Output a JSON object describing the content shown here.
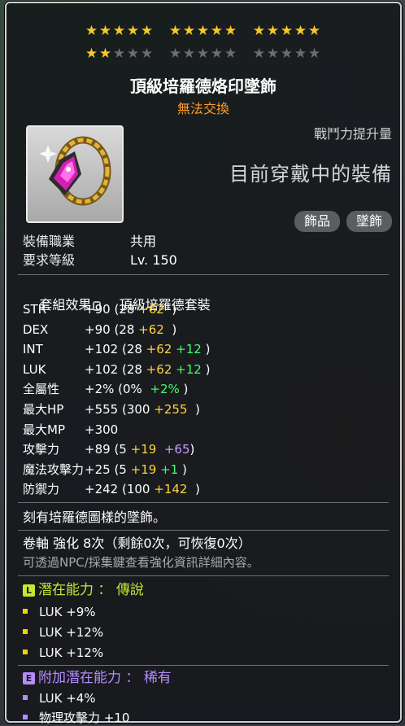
{
  "stars": {
    "rows": [
      [
        5,
        5,
        5
      ],
      [
        2,
        0,
        0
      ]
    ],
    "max_per_group": 5,
    "filled": 17
  },
  "item": {
    "name": "頂級培羅德烙印墜飾",
    "untradeable": "無法交換",
    "combat_power_label": "戰鬥力提升量",
    "equipped_text": "目前穿戴中的裝備",
    "tags": [
      "飾品",
      "墜飾"
    ],
    "icon": "gem-pendant-icon"
  },
  "requirements": [
    {
      "key": "裝備職業",
      "value": "共用"
    },
    {
      "key": "要求等級",
      "value": "Lv. 150"
    }
  ],
  "set_effect": {
    "label": "套組效果",
    "name": "頂級培羅德套裝"
  },
  "stats": [
    {
      "key": "STR",
      "total": "+90",
      "base": "(28",
      "yellow": "+62",
      "green": "",
      "purple": "",
      "close": ")"
    },
    {
      "key": "DEX",
      "total": "+90",
      "base": "(28",
      "yellow": "+62",
      "green": "",
      "purple": "",
      "close": ")"
    },
    {
      "key": "INT",
      "total": "+102",
      "base": "(28",
      "yellow": "+62",
      "green": "+12",
      "purple": "",
      "close": ")"
    },
    {
      "key": "LUK",
      "total": "+102",
      "base": "(28",
      "yellow": "+62",
      "green": "+12",
      "purple": "",
      "close": ")"
    },
    {
      "key": "全屬性",
      "total": "+2%",
      "base": "(0%",
      "yellow": "",
      "green": "+2%",
      "purple": "",
      "close": ")"
    },
    {
      "key": "最大HP",
      "total": "+555",
      "base": "(300",
      "yellow": "+255",
      "green": "",
      "purple": "",
      "close": ")"
    },
    {
      "key": "最大MP",
      "total": "+300",
      "base": "",
      "yellow": "",
      "green": "",
      "purple": "",
      "close": ""
    },
    {
      "key": "攻擊力",
      "total": "+89",
      "base": "(5",
      "yellow": "+19",
      "green": "",
      "purple": "+65",
      "close": ")"
    },
    {
      "key": "魔法攻擊力",
      "total": "+25",
      "base": "(5",
      "yellow": "+19",
      "green": "+1",
      "purple": "",
      "close": ")"
    },
    {
      "key": "防禦力",
      "total": "+242",
      "base": "(100",
      "yellow": "+142",
      "green": "",
      "purple": "",
      "close": ")"
    }
  ],
  "description": "刻有培羅德圖樣的墜飾。",
  "scroll_line": "卷軸 強化 8次（剩餘0次，可恢復0次）",
  "npc_hint": "可透過NPC/採集鍵查看強化資訊詳細內容。",
  "potential": {
    "badge": "L",
    "label": "潛在能力",
    "sep": "：",
    "grade": "傳說",
    "color": "#c5e633",
    "lines": [
      "LUK +9%",
      "LUK +12%",
      "LUK +12%"
    ]
  },
  "additional": {
    "badge": "E",
    "label": "附加潛在能力",
    "sep": "：",
    "grade": "稀有",
    "color": "#b58cff",
    "lines": [
      "LUK +4%",
      "物理攻擊力 +10"
    ]
  }
}
